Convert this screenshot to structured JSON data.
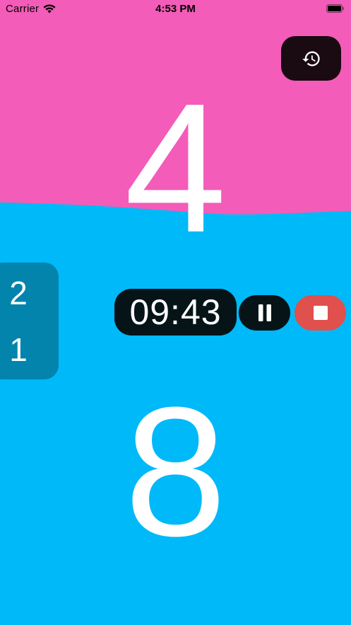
{
  "status_bar": {
    "carrier": "Carrier",
    "time": "4:53 PM"
  },
  "colors": {
    "top_team": "#F35CB8",
    "bottom_team": "#00B9F8",
    "side_panel": "#0384AC",
    "timer_bg": "#061418",
    "stop_button": "#E0504C",
    "history_button": "#1A0A12"
  },
  "scoreboard": {
    "top_score": "4",
    "bottom_score": "8"
  },
  "sets_panel": {
    "top_sets": "2",
    "bottom_sets": "1"
  },
  "timer": {
    "display": "09:43"
  },
  "icons": {
    "history": "history-icon",
    "pause": "pause-icon",
    "stop": "stop-icon"
  }
}
